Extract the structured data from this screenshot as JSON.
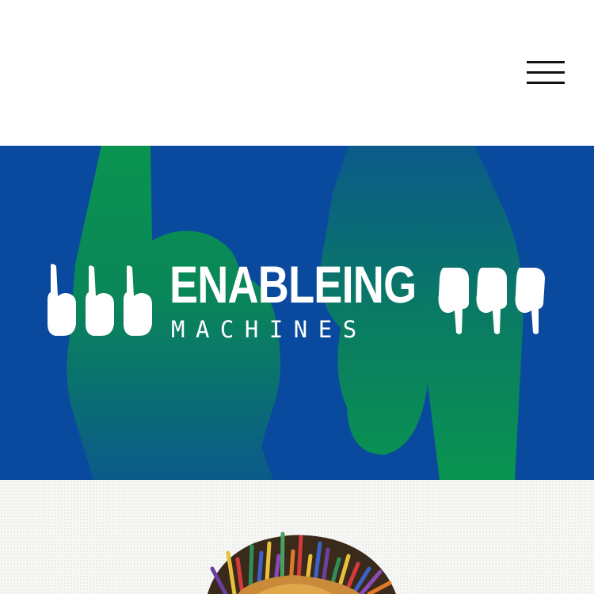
{
  "header": {
    "menu_icon": "hamburger-menu-icon"
  },
  "hero": {
    "title": "ENABLEING",
    "subtitle": "MACHINES",
    "background_color": "#0a4a9e",
    "accent_color": "#0a8f4f",
    "left_icons": [
      "pointing-up-hand-icon",
      "pointing-up-hand-icon",
      "pointing-up-hand-icon"
    ],
    "right_icons": [
      "pointing-down-hand-icon",
      "pointing-down-hand-icon",
      "pointing-down-hand-icon"
    ]
  },
  "artwork": {
    "name": "colorful-portrait-illustration"
  }
}
